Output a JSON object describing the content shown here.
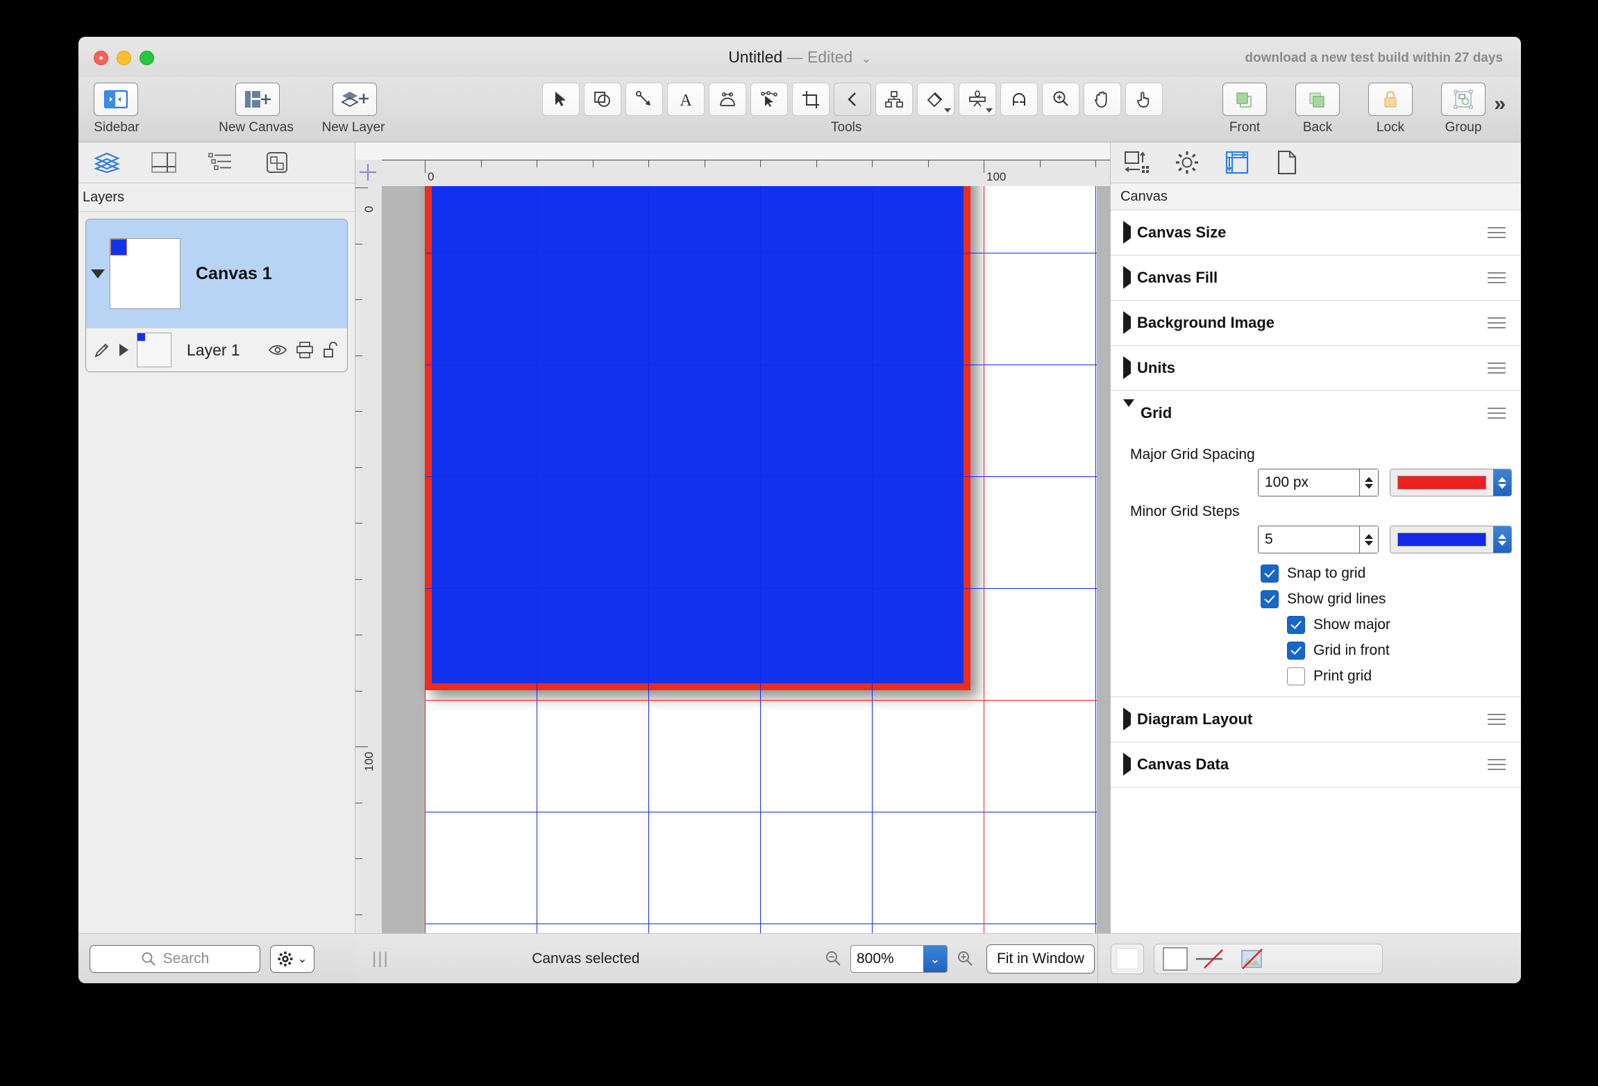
{
  "window": {
    "title": "Untitled",
    "separator": "—",
    "state": "Edited",
    "chevron": "⌄",
    "test_build_notice": "download a new test build within 27 days"
  },
  "toolbar": {
    "left_items": [
      {
        "label": "Sidebar",
        "icon": "sidebar-toggle-icon"
      },
      {
        "label": "New Canvas",
        "icon": "new-canvas-icon"
      },
      {
        "label": "New Layer",
        "icon": "new-layer-icon"
      }
    ],
    "tools_label": "Tools",
    "tools": [
      {
        "name": "selection-tool",
        "icon": "arrow-cursor-icon"
      },
      {
        "name": "shape-tool",
        "icon": "square-circle-icon"
      },
      {
        "name": "line-tool",
        "icon": "diagonal-arrow-icon"
      },
      {
        "name": "text-tool",
        "icon": "letter-a-icon"
      },
      {
        "name": "pen-tool",
        "icon": "bezier-curve-icon"
      },
      {
        "name": "point-editor-tool",
        "icon": "point-editor-icon"
      },
      {
        "name": "crop-tool",
        "icon": "crop-frame-icon"
      },
      {
        "name": "connection-tool",
        "icon": "chevron-left-icon"
      },
      {
        "name": "diagram-tool",
        "icon": "hierarchy-nodes-icon"
      },
      {
        "name": "style-brush-tool",
        "icon": "paint-brush-icon"
      },
      {
        "name": "shape-combine-tool",
        "icon": "shape-combine-icon"
      },
      {
        "name": "magnet-tool",
        "icon": "magnet-icon"
      },
      {
        "name": "zoom-tool",
        "icon": "magnifier-plus-icon"
      },
      {
        "name": "hand-tool",
        "icon": "open-hand-icon"
      },
      {
        "name": "browse-tool",
        "icon": "pointing-hand-icon"
      }
    ],
    "right_items": [
      {
        "label": "Front",
        "icon": "bring-front-icon"
      },
      {
        "label": "Back",
        "icon": "send-back-icon"
      },
      {
        "label": "Lock",
        "icon": "lock-icon"
      },
      {
        "label": "Group",
        "icon": "group-icon"
      }
    ],
    "overflow": "»"
  },
  "sidebar": {
    "tabs": [
      {
        "name": "layers-tab",
        "icon": "layers-stack-icon",
        "selected": true
      },
      {
        "name": "canvases-tab",
        "icon": "canvas-split-icon",
        "selected": false
      },
      {
        "name": "outline-tab",
        "icon": "outline-list-icon",
        "selected": false
      },
      {
        "name": "objects-tab",
        "icon": "objects-icon",
        "selected": false
      }
    ],
    "header": "Layers",
    "canvas": {
      "name": "Canvas 1",
      "selected": true
    },
    "layer": {
      "name": "Layer 1",
      "icons": [
        "pencil-icon",
        "disclosure-triangle-icon",
        "eye-icon",
        "print-icon",
        "unlock-icon"
      ]
    },
    "search": {
      "placeholder": "Search",
      "icon": "search-icon"
    },
    "action_menu": {
      "icon": "gear-icon",
      "chevron": "⌄"
    }
  },
  "canvas": {
    "ruler": {
      "h_labels": [
        "0",
        "100"
      ],
      "v_labels": [
        "0",
        "100"
      ],
      "unit": "px"
    },
    "shape": {
      "fill": "#1133ee",
      "stroke": "#ef2b1e"
    },
    "page_background": "#ffffff",
    "pasteboard": "#b6b6b6"
  },
  "inspector": {
    "tabs": [
      {
        "name": "geometry-tab",
        "icon": "resize-icon",
        "selected": false
      },
      {
        "name": "properties-tab",
        "icon": "gear-icon",
        "selected": false
      },
      {
        "name": "canvas-tab",
        "icon": "canvas-ruler-icon",
        "selected": true
      },
      {
        "name": "document-tab",
        "icon": "document-page-icon",
        "selected": false
      }
    ],
    "header": "Canvas",
    "sections": [
      {
        "title": "Canvas Size",
        "expanded": false
      },
      {
        "title": "Canvas Fill",
        "expanded": false
      },
      {
        "title": "Background Image",
        "expanded": false
      },
      {
        "title": "Units",
        "expanded": false
      },
      {
        "title": "Grid",
        "expanded": true
      },
      {
        "title": "Diagram Layout",
        "expanded": false
      },
      {
        "title": "Canvas Data",
        "expanded": false
      }
    ],
    "grid": {
      "major_label": "Major Grid Spacing",
      "major_value": "100 px",
      "major_color": "#ee1f1f",
      "minor_label": "Minor Grid Steps",
      "minor_value": "5",
      "minor_color": "#1428e8",
      "checkboxes": [
        {
          "label": "Snap to grid",
          "checked": true,
          "indent": 0
        },
        {
          "label": "Show grid lines",
          "checked": true,
          "indent": 0
        },
        {
          "label": "Show major",
          "checked": true,
          "indent": 1
        },
        {
          "label": "Grid in front",
          "checked": true,
          "indent": 1
        },
        {
          "label": "Print grid",
          "checked": false,
          "indent": 1
        }
      ]
    }
  },
  "status_bar": {
    "status": "Canvas selected",
    "zoom_value": "800%",
    "zoom_chevron": "⌄",
    "fit_label": "Fit in Window",
    "zoom_out_icon": "magnifier-minus-icon",
    "zoom_in_icon": "magnifier-plus-icon",
    "grip_icon": "resize-grip-icon"
  },
  "chart_data": null
}
